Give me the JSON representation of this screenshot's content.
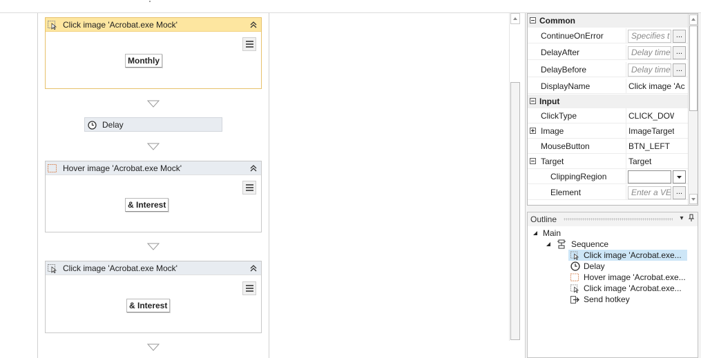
{
  "designer": {
    "activities": [
      {
        "title": "Click image 'Acrobat.exe Mock'",
        "target_text": "Monthly"
      },
      {
        "title": "Hover image 'Acrobat.exe Mock'",
        "target_text": "& Interest"
      },
      {
        "title": "Click image 'Acrobat.exe Mock'",
        "target_text": "& Interest"
      }
    ],
    "delay_label": "Delay"
  },
  "properties": {
    "categories": {
      "common": "Common",
      "input": "Input"
    },
    "rows": [
      {
        "name": "ContinueOnError",
        "placeholder": "Specifies t",
        "button": "..."
      },
      {
        "name": "DelayAfter",
        "placeholder": "Delay time",
        "button": "..."
      },
      {
        "name": "DelayBefore",
        "placeholder": "Delay time",
        "button": "..."
      },
      {
        "name": "DisplayName",
        "value": "Click image 'Ac"
      },
      {
        "name": "ClickType",
        "value": "CLICK_DOW"
      },
      {
        "name": "Image",
        "value": "ImageTarget"
      },
      {
        "name": "MouseButton",
        "value": "BTN_LEFT"
      },
      {
        "name": "Target",
        "value": "Target"
      },
      {
        "name": "ClippingRegion",
        "value": ""
      },
      {
        "name": "Element",
        "placeholder": "Enter a VE",
        "button": "..."
      }
    ]
  },
  "outline": {
    "title": "Outline",
    "items": [
      {
        "label": "Main",
        "icon": "expand-triangle"
      },
      {
        "label": "Sequence",
        "icon": "sequence-icon"
      },
      {
        "label": "Click image 'Acrobat.exe...",
        "icon": "click-image-icon",
        "selected": true
      },
      {
        "label": "Delay",
        "icon": "clock-icon"
      },
      {
        "label": "Hover image 'Acrobat.exe...",
        "icon": "hover-image-icon"
      },
      {
        "label": "Click image 'Acrobat.exe...",
        "icon": "click-image-icon"
      },
      {
        "label": "Send hotkey",
        "icon": "send-hotkey-icon"
      }
    ]
  },
  "colors": {
    "selected_header": "#fde6a0",
    "selected_border": "#e7c16a",
    "header": "#e8ecf1",
    "tree_selection": "#cde6f7"
  }
}
